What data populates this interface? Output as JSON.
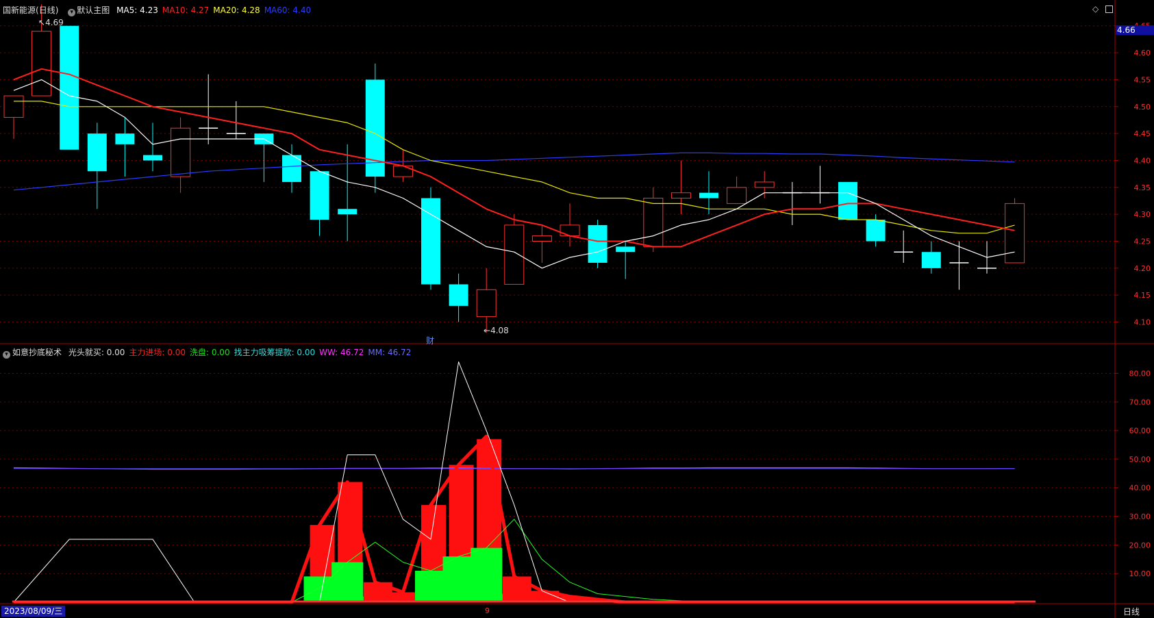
{
  "main_panel": {
    "stock": "国新能源",
    "period": "(日线)",
    "main_label": "默认主图",
    "ma": [
      {
        "label": "MA5: 4.23",
        "color": "#ffffff"
      },
      {
        "label": "MA10: 4.27",
        "color": "#ff2020"
      },
      {
        "label": "MA20: 4.28",
        "color": "#ffff33"
      },
      {
        "label": "MA60: 4.40",
        "color": "#2b3cff"
      }
    ],
    "high_mark": "4.69",
    "low_mark": "4.08",
    "cai_label": "财",
    "last_price": "4.66",
    "y_ticks": [
      "4.65",
      "4.60",
      "4.55",
      "4.50",
      "4.45",
      "4.40",
      "4.35",
      "4.30",
      "4.25",
      "4.20",
      "4.15",
      "4.10"
    ]
  },
  "sub_panel": {
    "name": "如意抄底秘术",
    "items": [
      {
        "label": "光头就买: 0.00",
        "color": "#dddddd"
      },
      {
        "label": "主力进场: 0.00",
        "color": "#ff2020"
      },
      {
        "label": "洗盘: 0.00",
        "color": "#22dd22"
      },
      {
        "label": "找主力吸筹提款: 0.00",
        "color": "#33dddd"
      },
      {
        "label": "WW: 46.72",
        "color": "#ff33ff"
      },
      {
        "label": "MM: 46.72",
        "color": "#6a6aff"
      }
    ],
    "y_ticks": [
      "80.00",
      "70.00",
      "60.00",
      "50.00",
      "40.00",
      "30.00",
      "20.00",
      "10.00"
    ]
  },
  "bottom_bar": {
    "date": "2023/08/09/三",
    "marker": "9",
    "period_button": "日线"
  },
  "colors": {
    "up": "#ff3030",
    "down": "#00ffff",
    "ma5": "#ffffff",
    "ma10": "#ff2020",
    "ma20": "#e8e800",
    "ma60": "#2b3cff",
    "grid": "#7a0000",
    "axis": "#aa0000",
    "text": "#dddddd"
  },
  "chart_data": {
    "type": "candlestick",
    "price_range": [
      4.06,
      4.67
    ],
    "candles": [
      {
        "o": 4.48,
        "c": 4.52,
        "h": 4.52,
        "l": 4.44
      },
      {
        "o": 4.52,
        "c": 4.64,
        "h": 4.69,
        "l": 4.52
      },
      {
        "o": 4.65,
        "c": 4.42,
        "h": 4.65,
        "l": 4.42
      },
      {
        "o": 4.45,
        "c": 4.38,
        "h": 4.47,
        "l": 4.31
      },
      {
        "o": 4.45,
        "c": 4.43,
        "h": 4.48,
        "l": 4.37
      },
      {
        "o": 4.41,
        "c": 4.4,
        "h": 4.47,
        "l": 4.38
      },
      {
        "o": 4.37,
        "c": 4.46,
        "h": 4.48,
        "l": 4.34
      },
      {
        "o": 4.46,
        "c": 4.46,
        "h": 4.56,
        "l": 4.43
      },
      {
        "o": 4.45,
        "c": 4.45,
        "h": 4.51,
        "l": 4.44
      },
      {
        "o": 4.45,
        "c": 4.43,
        "h": 4.45,
        "l": 4.36
      },
      {
        "o": 4.41,
        "c": 4.36,
        "h": 4.43,
        "l": 4.34
      },
      {
        "o": 4.38,
        "c": 4.29,
        "h": 4.38,
        "l": 4.26
      },
      {
        "o": 4.31,
        "c": 4.3,
        "h": 4.43,
        "l": 4.25
      },
      {
        "o": 4.55,
        "c": 4.37,
        "h": 4.58,
        "l": 4.34
      },
      {
        "o": 4.37,
        "c": 4.39,
        "h": 4.42,
        "l": 4.36
      },
      {
        "o": 4.33,
        "c": 4.17,
        "h": 4.35,
        "l": 4.16
      },
      {
        "o": 4.17,
        "c": 4.13,
        "h": 4.19,
        "l": 4.1
      },
      {
        "o": 4.11,
        "c": 4.16,
        "h": 4.2,
        "l": 4.08
      },
      {
        "o": 4.17,
        "c": 4.28,
        "h": 4.3,
        "l": 4.17
      },
      {
        "o": 4.25,
        "c": 4.26,
        "h": 4.28,
        "l": 4.21
      },
      {
        "o": 4.26,
        "c": 4.28,
        "h": 4.32,
        "l": 4.24
      },
      {
        "o": 4.28,
        "c": 4.21,
        "h": 4.29,
        "l": 4.2
      },
      {
        "o": 4.24,
        "c": 4.23,
        "h": 4.25,
        "l": 4.18
      },
      {
        "o": 4.24,
        "c": 4.33,
        "h": 4.35,
        "l": 4.23
      },
      {
        "o": 4.33,
        "c": 4.34,
        "h": 4.4,
        "l": 4.3
      },
      {
        "o": 4.34,
        "c": 4.33,
        "h": 4.38,
        "l": 4.3
      },
      {
        "o": 4.32,
        "c": 4.35,
        "h": 4.37,
        "l": 4.32
      },
      {
        "o": 4.35,
        "c": 4.36,
        "h": 4.38,
        "l": 4.33
      },
      {
        "o": 4.34,
        "c": 4.34,
        "h": 4.36,
        "l": 4.28
      },
      {
        "o": 4.34,
        "c": 4.34,
        "h": 4.39,
        "l": 4.32
      },
      {
        "o": 4.36,
        "c": 4.29,
        "h": 4.36,
        "l": 4.29
      },
      {
        "o": 4.29,
        "c": 4.25,
        "h": 4.3,
        "l": 4.24
      },
      {
        "o": 4.23,
        "c": 4.23,
        "h": 4.27,
        "l": 4.21
      },
      {
        "o": 4.23,
        "c": 4.2,
        "h": 4.25,
        "l": 4.19
      },
      {
        "o": 4.21,
        "c": 4.21,
        "h": 4.25,
        "l": 4.16
      },
      {
        "o": 4.2,
        "c": 4.2,
        "h": 4.25,
        "l": 4.19
      },
      {
        "o": 4.21,
        "c": 4.32,
        "h": 4.33,
        "l": 4.21
      }
    ],
    "ma5": [
      4.53,
      4.55,
      4.52,
      4.51,
      4.48,
      4.43,
      4.44,
      4.44,
      4.44,
      4.44,
      4.41,
      4.38,
      4.36,
      4.35,
      4.33,
      4.3,
      4.27,
      4.24,
      4.23,
      4.2,
      4.22,
      4.23,
      4.25,
      4.26,
      4.28,
      4.29,
      4.31,
      4.34,
      4.34,
      4.34,
      4.34,
      4.32,
      4.29,
      4.26,
      4.24,
      4.22,
      4.23
    ],
    "ma10": [
      4.55,
      4.57,
      4.56,
      4.54,
      4.52,
      4.5,
      4.49,
      4.48,
      4.47,
      4.46,
      4.45,
      4.42,
      4.41,
      4.4,
      4.39,
      4.37,
      4.34,
      4.31,
      4.29,
      4.28,
      4.26,
      4.25,
      4.25,
      4.24,
      4.24,
      4.26,
      4.28,
      4.3,
      4.31,
      4.31,
      4.32,
      4.32,
      4.31,
      4.3,
      4.29,
      4.28,
      4.27
    ],
    "ma20": [
      4.51,
      4.51,
      4.5,
      4.5,
      4.5,
      4.5,
      4.5,
      4.5,
      4.5,
      4.5,
      4.49,
      4.48,
      4.47,
      4.45,
      4.42,
      4.4,
      4.39,
      4.38,
      4.37,
      4.36,
      4.34,
      4.33,
      4.33,
      4.32,
      4.32,
      4.31,
      4.31,
      4.31,
      4.3,
      4.3,
      4.29,
      4.29,
      4.28,
      4.27,
      4.265,
      4.265,
      4.28
    ],
    "ma60": [
      4.345,
      4.35,
      4.355,
      4.36,
      4.365,
      4.37,
      4.375,
      4.38,
      4.383,
      4.386,
      4.389,
      4.392,
      4.394,
      4.396,
      4.398,
      4.4,
      4.4,
      4.4,
      4.402,
      4.404,
      4.406,
      4.408,
      4.41,
      4.412,
      4.414,
      4.414,
      4.413,
      4.413,
      4.412,
      4.412,
      4.41,
      4.408,
      4.405,
      4.403,
      4.401,
      4.399,
      4.397
    ],
    "indicator": {
      "range": [
        0,
        88
      ],
      "white": [
        0,
        0,
        0,
        0,
        0,
        0,
        0,
        0,
        0,
        0,
        0,
        0,
        51.5,
        51.5,
        29,
        22,
        84,
        60,
        34,
        4,
        0,
        0,
        0,
        0,
        0,
        0,
        0,
        0,
        0,
        0,
        0,
        0,
        0,
        0,
        0,
        0,
        0
      ],
      "white_early": [
        [
          0.0,
          0
        ],
        [
          2.0,
          22
        ],
        [
          5.0,
          22
        ],
        [
          6.5,
          0
        ]
      ],
      "red_bars": [
        0,
        0,
        0,
        0,
        0,
        0,
        0,
        0,
        0,
        0,
        0,
        27,
        42,
        7,
        3.5,
        34,
        48,
        57,
        9,
        4,
        2,
        1,
        0,
        0,
        0,
        0,
        0,
        0,
        0,
        0,
        0,
        0,
        0,
        0,
        0,
        0,
        0
      ],
      "red_line": [
        0,
        0,
        0,
        0,
        0,
        0,
        0,
        0,
        0,
        0,
        0,
        27,
        42,
        7,
        3.5,
        34,
        48,
        58,
        9,
        4,
        2,
        1,
        0,
        0,
        0,
        0,
        0,
        0,
        0,
        0,
        0,
        0,
        0,
        0,
        0,
        0,
        0
      ],
      "green_bars": [
        0,
        0,
        0,
        0,
        0,
        0,
        0,
        0,
        0,
        0,
        0,
        9,
        14,
        2,
        0,
        11,
        16,
        19,
        3,
        1,
        0,
        0,
        0,
        0,
        0,
        0,
        0,
        0,
        0,
        0,
        0,
        0,
        0,
        0,
        0,
        0,
        0
      ],
      "green_line": [
        0,
        0,
        0,
        0,
        0,
        0,
        0,
        0,
        0,
        0,
        0,
        5,
        14,
        21,
        14,
        11,
        16,
        19,
        29,
        15,
        7,
        3,
        2,
        1,
        0.5,
        0,
        0,
        0,
        0,
        0,
        0,
        0,
        0,
        0,
        0,
        0,
        0
      ],
      "ww": [
        47,
        46.9,
        46.8,
        46.7,
        46.6,
        46.5,
        46.5,
        46.5,
        46.5,
        46.6,
        46.6,
        46.7,
        46.8,
        46.8,
        46.8,
        46.9,
        46.9,
        46.8,
        46.7,
        46.7,
        46.6,
        46.7,
        46.8,
        46.9,
        46.9,
        47,
        47,
        47,
        47,
        47,
        47,
        46.9,
        46.8,
        46.7,
        46.7,
        46.7,
        46.72
      ],
      "mm": [
        46.7,
        46.7,
        46.7,
        46.7,
        46.7,
        46.7,
        46.7,
        46.7,
        46.7,
        46.7,
        46.7,
        46.7,
        46.7,
        46.7,
        46.7,
        46.7,
        46.7,
        46.7,
        46.7,
        46.7,
        46.7,
        46.7,
        46.7,
        46.7,
        46.7,
        46.7,
        46.7,
        46.7,
        46.7,
        46.7,
        46.7,
        46.7,
        46.7,
        46.7,
        46.7,
        46.7,
        46.72
      ]
    }
  }
}
